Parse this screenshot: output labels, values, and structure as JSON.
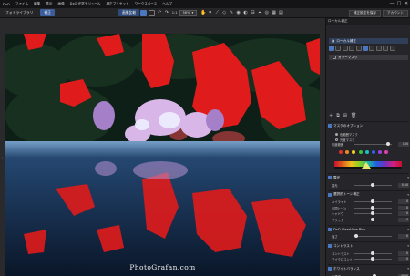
{
  "menubar": {
    "app_name": "DxO",
    "items": [
      "ファイル",
      "編集",
      "表示",
      "画像",
      "DxO 光学モジュール",
      "補正プリセット",
      "ワークスペース",
      "ヘルプ"
    ],
    "window_controls": [
      "—",
      "□",
      "✕"
    ]
  },
  "toolbar": {
    "photo_library_tab": "フォトライブラリ",
    "customize_tab": "補正",
    "compare_button": "画像比較",
    "zoom_value": "1:1",
    "fit_button": "56%",
    "right_buttons": [
      "補正設定を保存",
      "アカウント"
    ],
    "icons": [
      "hand-icon",
      "crop-icon",
      "straighten-icon",
      "perspective-icon",
      "retouch-icon",
      "redeye-icon",
      "local-adjust-icon",
      "horizon-icon",
      "picker-icon",
      "eye-icon",
      "grid-icon",
      "histogram-icon"
    ]
  },
  "panel": {
    "tabs": [
      "ローカル補正",
      "☐"
    ],
    "layer_header": "ローカル補正",
    "layer_name": "カラーマスク",
    "mask_section": "マスクのオプション",
    "radio_options": [
      "色範囲マスク",
      "光度マスク"
    ],
    "hue_label": "彩度範囲",
    "hue_value": "100",
    "swatch_colors": [
      "#e03030",
      "#f08a20",
      "#f0d020",
      "#40c040",
      "#20c0c0",
      "#3060f0",
      "#a040e0",
      "#e040b0"
    ],
    "sections": [
      {
        "title": "露光",
        "rows": [
          {
            "label": "露光",
            "value": "0.00",
            "level": 0.5
          }
        ]
      },
      {
        "title": "選択的トーン補正",
        "rows": [
          {
            "label": "ハイライト",
            "value": "0",
            "level": 0.5
          },
          {
            "label": "中間トーン",
            "value": "0",
            "level": 0.5
          },
          {
            "label": "シャドウ",
            "value": "0",
            "level": 0.5
          },
          {
            "label": "ブラック",
            "value": "0",
            "level": 0.5
          }
        ]
      },
      {
        "title": "DxO ClearView Plus",
        "rows": [
          {
            "label": "強さ",
            "value": "0",
            "level": 0.03
          }
        ]
      },
      {
        "title": "コントラスト",
        "rows": [
          {
            "label": "コントラスト",
            "value": "0",
            "level": 0.5
          },
          {
            "label": "マイクロコントラスト",
            "value": "0",
            "level": 0.5
          }
        ]
      },
      {
        "title": "ホワイトバランス",
        "rows": [
          {
            "label": "色温度",
            "value": "4000",
            "level": 0.55
          }
        ]
      }
    ]
  },
  "photo": {
    "watermark": "PhotoGrafan.com"
  }
}
